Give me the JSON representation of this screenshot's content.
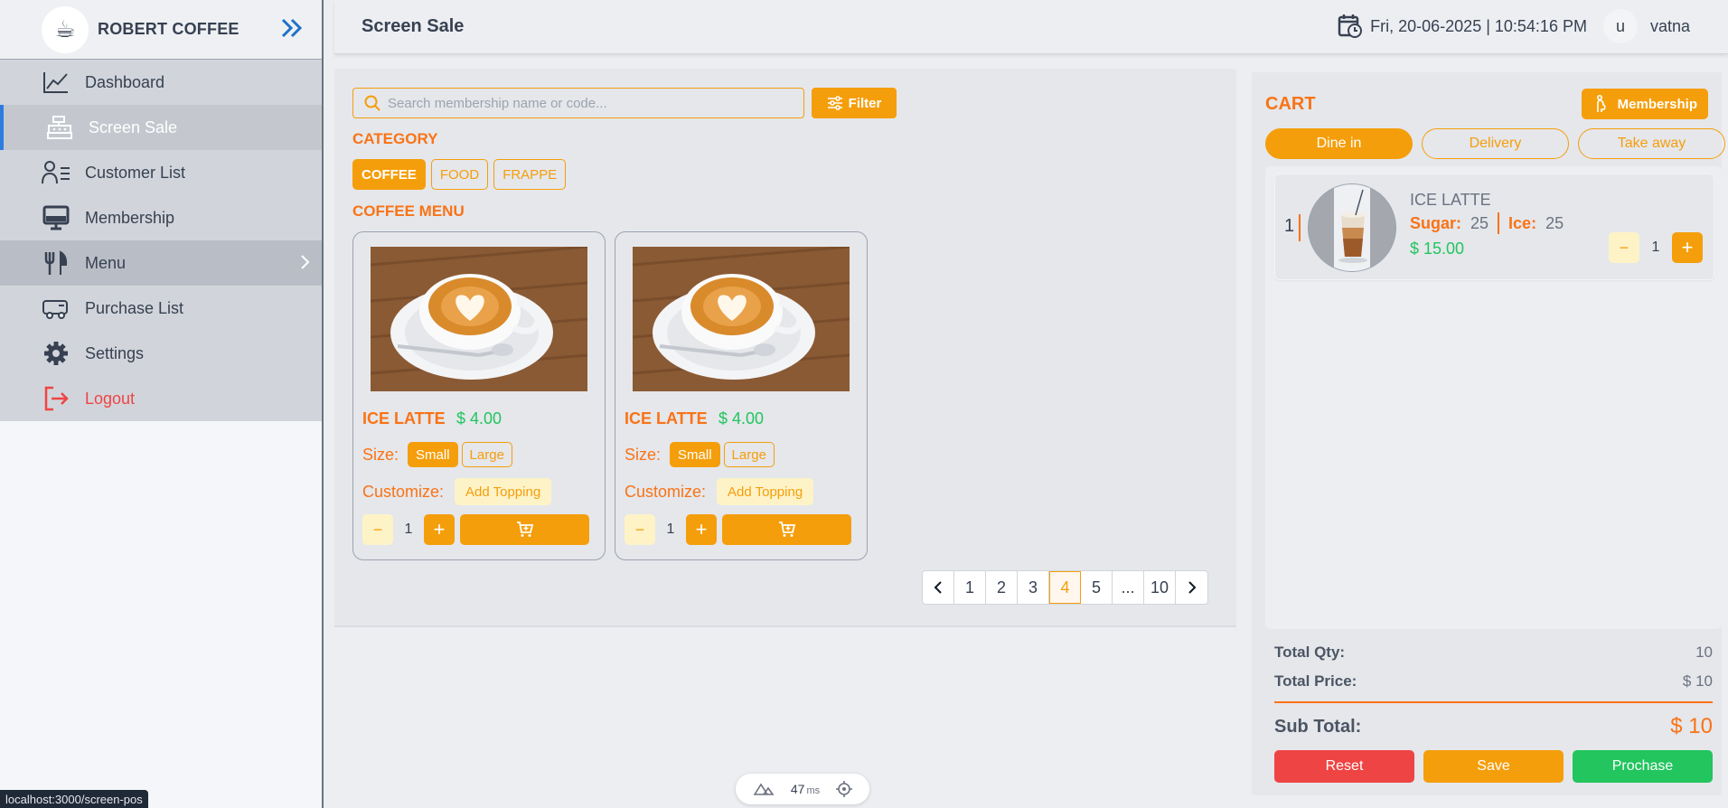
{
  "brand": {
    "name": "ROBERT COFFEE"
  },
  "sidebar": {
    "items": [
      {
        "label": "Dashboard",
        "icon": "chart-line-icon"
      },
      {
        "label": "Screen Sale",
        "icon": "cash-register-icon",
        "active": true
      },
      {
        "label": "Customer List",
        "icon": "user-list-icon"
      },
      {
        "label": "Membership",
        "icon": "monitor-icon"
      },
      {
        "label": "Menu",
        "icon": "fork-knife-icon",
        "has_submenu": true
      },
      {
        "label": "Purchase List",
        "icon": "truck-icon"
      },
      {
        "label": "Settings",
        "icon": "gear-icon"
      },
      {
        "label": "Logout",
        "icon": "logout-icon"
      }
    ]
  },
  "status_url": "localhost:3000/screen-pos",
  "header": {
    "title": "Screen Sale",
    "datetime": "Fri, 20-06-2025 | 10:54:16 PM",
    "avatar_letter": "u",
    "username": "vatna"
  },
  "search": {
    "placeholder": "Search membership name or code...",
    "value": ""
  },
  "filter_label": "Filter",
  "category": {
    "title": "CATEGORY",
    "items": [
      {
        "label": "COFFEE",
        "active": true
      },
      {
        "label": "FOOD",
        "active": false
      },
      {
        "label": "FRAPPE",
        "active": false
      }
    ]
  },
  "menu_title": "COFFEE MENU",
  "products": [
    {
      "name": "ICE LATTE",
      "price": "$ 4.00",
      "size_label": "Size:",
      "sizes": [
        "Small",
        "Large"
      ],
      "selected_size": "Small",
      "customize_label": "Customize:",
      "topping_label": "Add Topping",
      "qty": "1"
    },
    {
      "name": "ICE LATTE",
      "price": "$ 4.00",
      "size_label": "Size:",
      "sizes": [
        "Small",
        "Large"
      ],
      "selected_size": "Small",
      "customize_label": "Customize:",
      "topping_label": "Add Topping",
      "qty": "1"
    }
  ],
  "pagination": {
    "pages": [
      "1",
      "2",
      "3",
      "4",
      "5",
      "...",
      "10"
    ],
    "current": "4"
  },
  "perf": {
    "value": "47",
    "unit": "ms"
  },
  "cart": {
    "title": "CART",
    "membership_label": "Membership",
    "order_types": [
      {
        "label": "Dine in",
        "active": true
      },
      {
        "label": "Delivery",
        "active": false
      },
      {
        "label": "Take away",
        "active": false
      }
    ],
    "items": [
      {
        "index": "1",
        "name": "ICE LATTE",
        "sugar_label": "Sugar:",
        "sugar": "25",
        "ice_label": "Ice:",
        "ice": "25",
        "price": "$ 15.00",
        "qty": "1"
      }
    ],
    "total_qty_label": "Total Qty:",
    "total_qty": "10",
    "total_price_label": "Total Price:",
    "total_price": "$ 10",
    "subtotal_label": "Sub Total:",
    "subtotal": "$ 10",
    "reset_label": "Reset",
    "save_label": "Save",
    "purchase_label": "Prochase"
  },
  "colors": {
    "accent": "#f59e0b",
    "title_orange": "#f97316",
    "price_green": "#22c55e",
    "danger": "#ef4444",
    "active_border": "#2b7de0"
  }
}
